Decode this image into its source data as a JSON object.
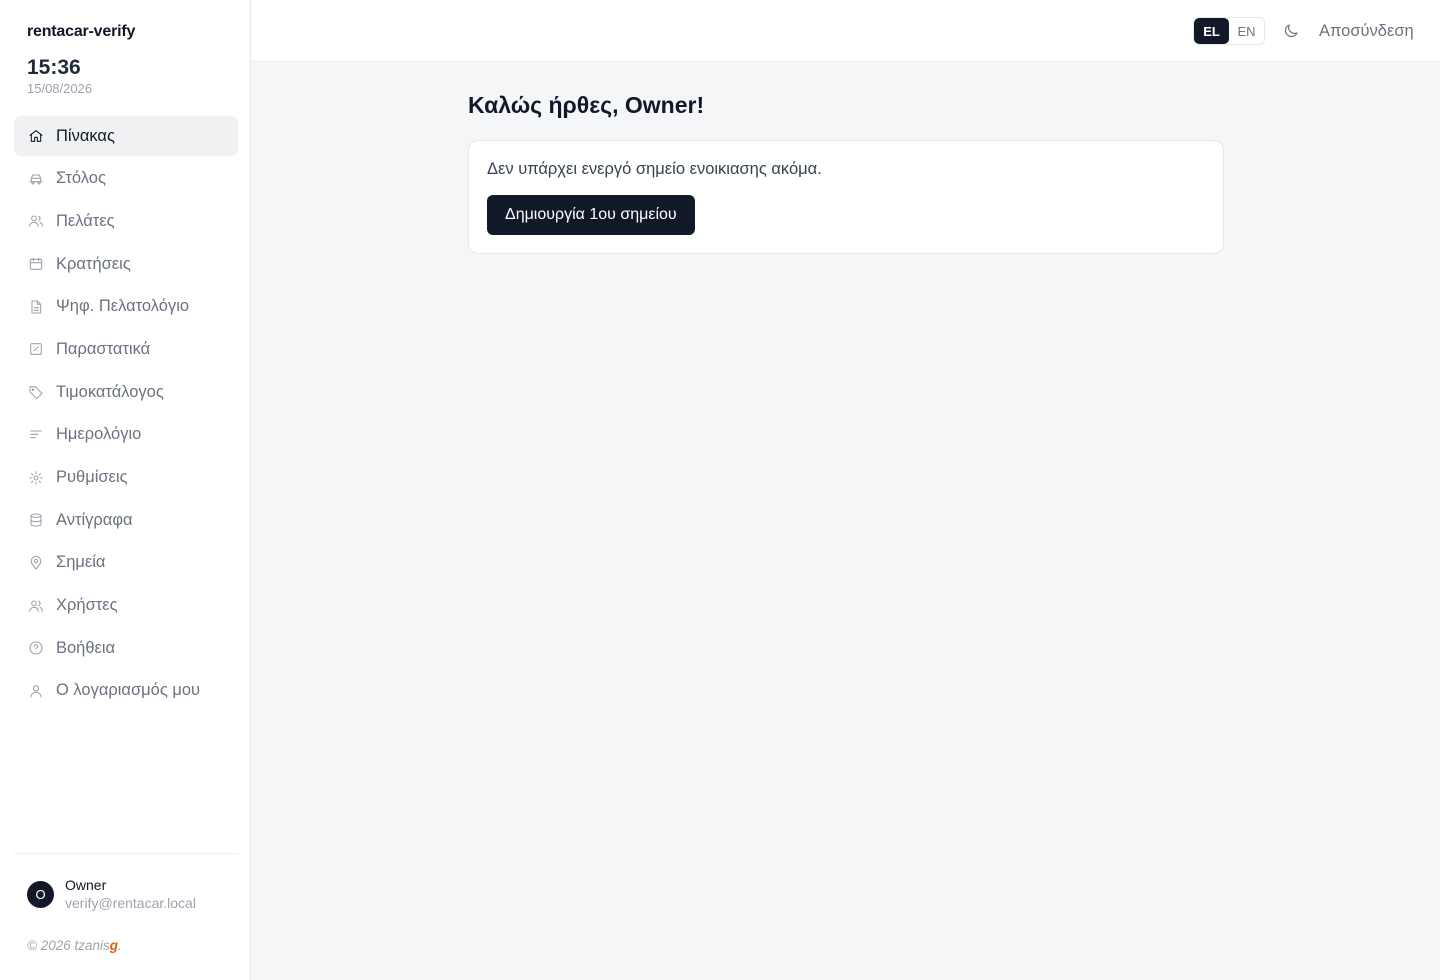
{
  "app": {
    "brand": "rentacar-verify",
    "time": "15:36",
    "date": "15/08/2026"
  },
  "sidebar": {
    "items": [
      {
        "label": "Πίνακας",
        "icon": "home-icon",
        "active": true
      },
      {
        "label": "Στόλος",
        "icon": "car-icon",
        "active": false
      },
      {
        "label": "Πελάτες",
        "icon": "users-icon",
        "active": false
      },
      {
        "label": "Κρατήσεις",
        "icon": "calendar-icon",
        "active": false
      },
      {
        "label": "Ψηφ. Πελατολόγιο",
        "icon": "document-icon",
        "active": false
      },
      {
        "label": "Παραστατικά",
        "icon": "invoice-icon",
        "active": false
      },
      {
        "label": "Τιμοκατάλογος",
        "icon": "tag-icon",
        "active": false
      },
      {
        "label": "Ημερολόγιο",
        "icon": "list-icon",
        "active": false
      },
      {
        "label": "Ρυθμίσεις",
        "icon": "gear-icon",
        "active": false
      },
      {
        "label": "Αντίγραφα",
        "icon": "database-icon",
        "active": false
      },
      {
        "label": "Σημεία",
        "icon": "map-pin-icon",
        "active": false
      },
      {
        "label": "Χρήστες",
        "icon": "users-icon",
        "active": false
      },
      {
        "label": "Βοήθεια",
        "icon": "help-circle-icon",
        "active": false
      },
      {
        "label": "Ο λογαριασμός μου",
        "icon": "user-icon",
        "active": false
      }
    ],
    "user": {
      "initial": "O",
      "name": "Owner",
      "email": "verify@rentacar.local"
    },
    "copyright_prefix": "© 2026 tzanis",
    "copyright_accent": "g",
    "copyright_suffix": "."
  },
  "header": {
    "languages": [
      {
        "code": "EL",
        "active": true
      },
      {
        "code": "EN",
        "active": false
      }
    ],
    "theme_icon": "moon-icon",
    "logout_label": "Αποσύνδεση"
  },
  "main": {
    "title": "Καλώς ήρθες, Owner!",
    "card": {
      "message": "Δεν υπάρχει ενεργό σημείο ενοικιασης ακόμα.",
      "button_label": "Δημιουργία 1ου σημείου"
    }
  },
  "colors": {
    "primary": "#111827",
    "accent": "#ea580c",
    "background": "#f5f6f8"
  }
}
